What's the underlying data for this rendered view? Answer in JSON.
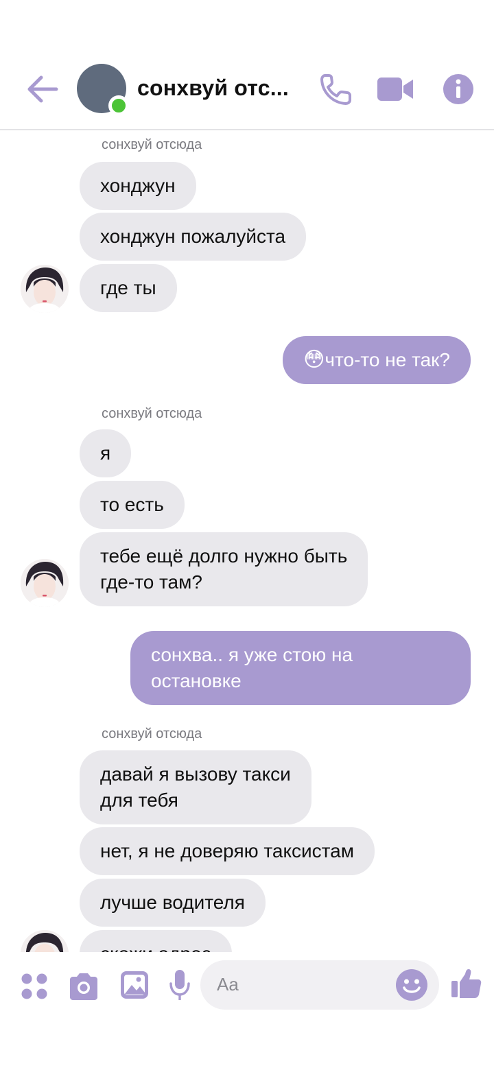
{
  "header": {
    "title": "сонхвуй отс...",
    "back_icon": "arrow-left-icon",
    "call_icon": "phone-icon",
    "video_icon": "video-camera-icon",
    "info_icon": "info-icon",
    "accent": "#a89ad0",
    "online_color": "#4cc437"
  },
  "messages": [
    {
      "sender": "сонхвуй отсюда"
    },
    {
      "text": "хонджун"
    },
    {
      "text": "хонджун пожалуйста"
    },
    {
      "text": "где ты"
    },
    {
      "text": "что-то не так?",
      "emoji": "😳"
    },
    {
      "sender": "сонхвуй отсюда"
    },
    {
      "text": "я"
    },
    {
      "text": "то есть"
    },
    {
      "line1": "тебе ещё долго нужно быть",
      "line2": "где-то там?"
    },
    {
      "line1": "сонхва.. я уже стою на",
      "line2": "остановке"
    },
    {
      "sender": "сонхвуй отсюда"
    },
    {
      "line1": "давай я вызову такси",
      "line2": "для тебя"
    },
    {
      "text": "нет, я не доверяю таксистам"
    },
    {
      "text": "лучше водителя"
    },
    {
      "text": "скажи адрес"
    }
  ],
  "composer": {
    "placeholder": "Aa",
    "apps_icon": "apps-icon",
    "camera_icon": "camera-icon",
    "gallery_icon": "image-icon",
    "mic_icon": "microphone-icon",
    "emoji_icon": "smiley-icon",
    "like_icon": "thumbs-up-icon"
  }
}
